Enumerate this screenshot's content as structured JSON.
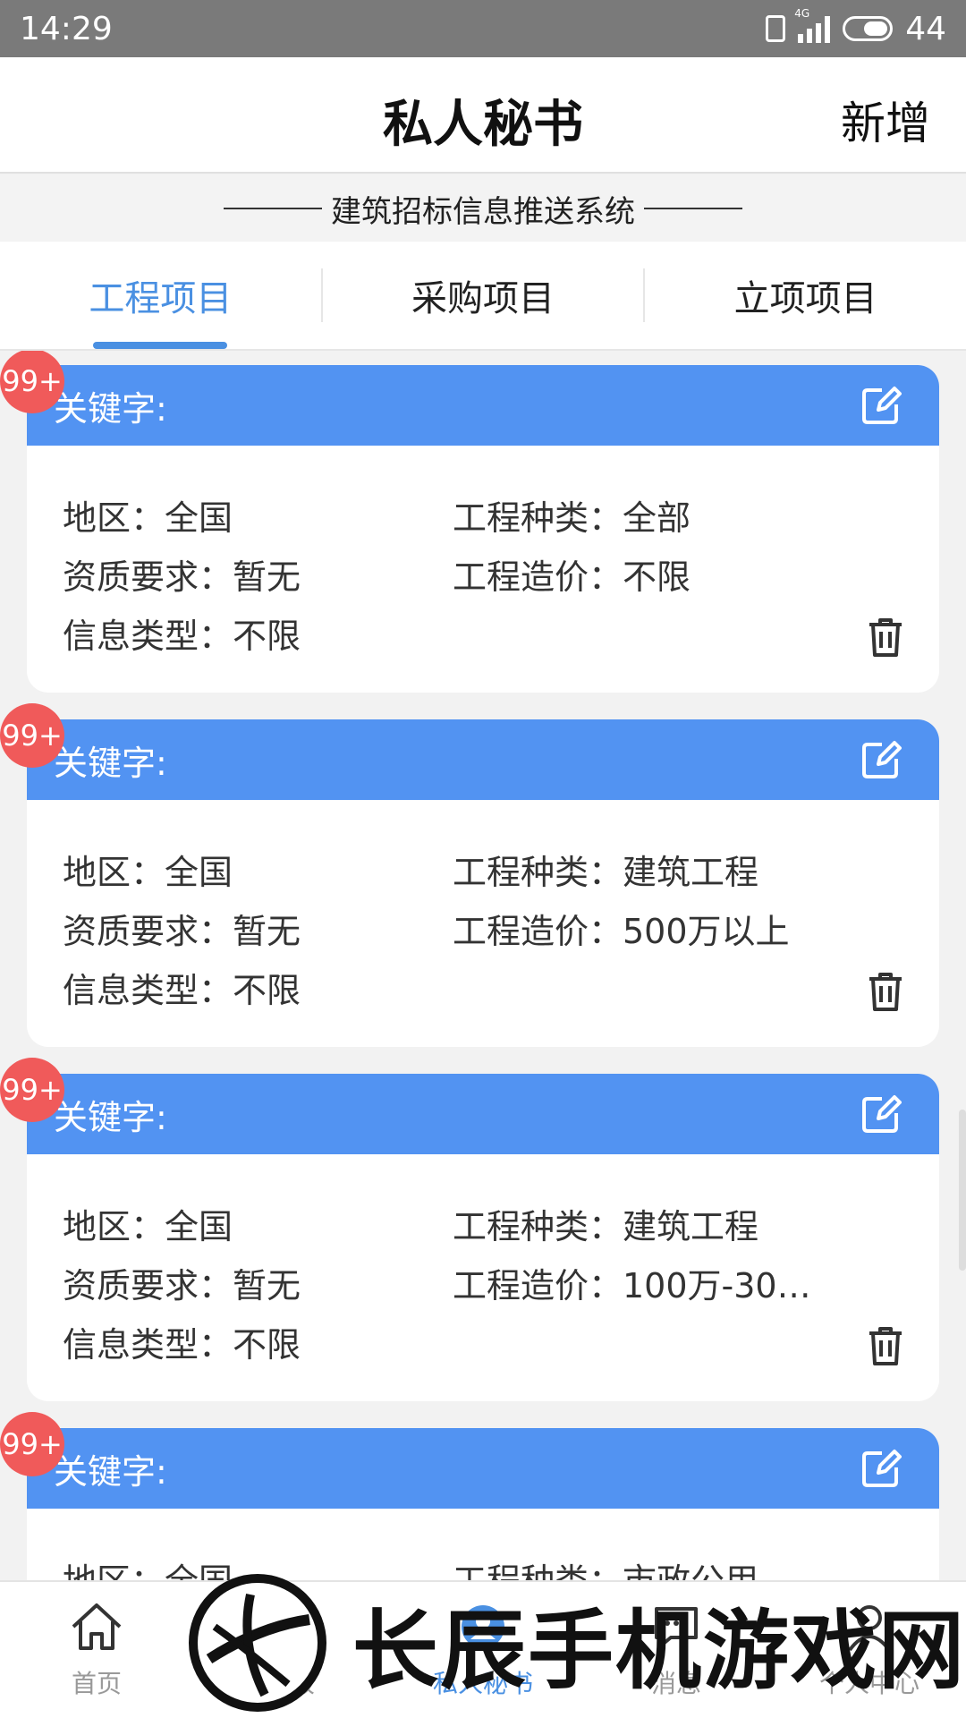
{
  "status_bar": {
    "time": "14:29",
    "network": "4G",
    "battery": "44"
  },
  "header": {
    "title": "私人秘书",
    "add_label": "新增"
  },
  "subtitle": "建筑招标信息推送系统",
  "tabs": [
    {
      "label": "工程项目",
      "active": true
    },
    {
      "label": "采购项目",
      "active": false
    },
    {
      "label": "立项项目",
      "active": false
    }
  ],
  "cards": [
    {
      "badge": "99+",
      "keyword_label": "关键字:",
      "region": "地区：全国",
      "category": "工程种类：全部",
      "qualification": "资质要求：暂无",
      "cost": "工程造价：不限",
      "info_type": "信息类型：不限"
    },
    {
      "badge": "99+",
      "keyword_label": "关键字:",
      "region": "地区：全国",
      "category": "工程种类：建筑工程",
      "qualification": "资质要求：暂无",
      "cost": "工程造价：500万以上",
      "info_type": "信息类型：不限"
    },
    {
      "badge": "99+",
      "keyword_label": "关键字:",
      "region": "地区：全国",
      "category": "工程种类：建筑工程",
      "qualification": "资质要求：暂无",
      "cost": "工程造价：100万-30…",
      "info_type": "信息类型：不限"
    },
    {
      "badge": "99+",
      "keyword_label": "关键字:",
      "region": "地区：全国",
      "category": "工程种类：市政公用",
      "qualification": "",
      "cost": "",
      "info_type": ""
    }
  ],
  "bottom_nav": [
    {
      "label": "首页",
      "icon": "home-icon",
      "active": false
    },
    {
      "label": "时报",
      "icon": "news-icon",
      "active": false
    },
    {
      "label": "私人秘书",
      "icon": "secretary-icon",
      "active": true
    },
    {
      "label": "消息",
      "icon": "message-icon",
      "active": false
    },
    {
      "label": "个人中心",
      "icon": "user-icon",
      "active": false
    }
  ],
  "watermark": {
    "text": "长辰手机游戏网"
  },
  "colors": {
    "accent": "#4a90e2",
    "card_header": "#5293f2",
    "badge": "#f05a5a"
  }
}
